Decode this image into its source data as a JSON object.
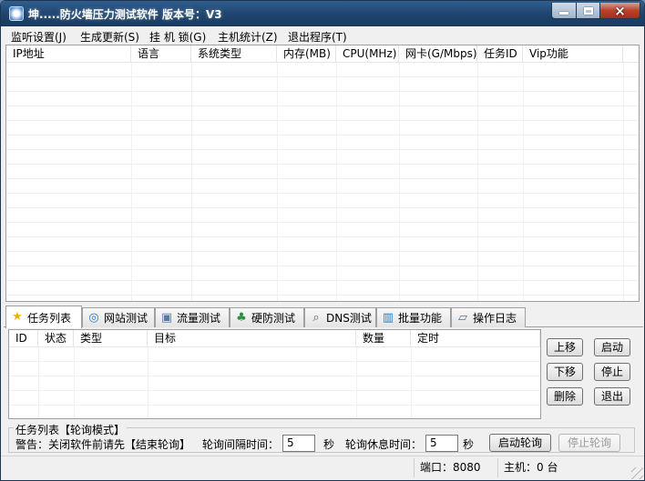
{
  "window": {
    "title": "坤.....防火墙压力测试软件  版本号：V3"
  },
  "menu": [
    "监听设置(J)",
    "生成更新(S)",
    "挂 机 锁(G)",
    "主机统计(Z)",
    "退出程序(T)"
  ],
  "host_table": {
    "headers": [
      "IP地址",
      "语言",
      "系统类型",
      "内存(MB)",
      "CPU(MHz)",
      "网卡(G/Mbps)",
      "任务ID",
      "Vip功能"
    ]
  },
  "tabs": [
    {
      "label": "任务列表",
      "icon": "star-icon"
    },
    {
      "label": "网站测试",
      "icon": "globe-icon"
    },
    {
      "label": "流量测试",
      "icon": "cube-icon"
    },
    {
      "label": "硬防测试",
      "icon": "network-icon"
    },
    {
      "label": "DNS测试",
      "icon": "magnifier-icon"
    },
    {
      "label": "批量功能",
      "icon": "bar-chart-icon"
    },
    {
      "label": "操作日志",
      "icon": "chat-bubbles-icon"
    }
  ],
  "task_table": {
    "headers": [
      "ID",
      "状态",
      "类型",
      "目标",
      "数量",
      "定时"
    ]
  },
  "side_buttons": {
    "move_up": "上移",
    "start": "启动",
    "move_down": "下移",
    "stop": "停止",
    "delete": "删除",
    "exit": "退出"
  },
  "polling": {
    "group_title": "任务列表【轮询模式】",
    "warning": "警告：关闭软件前请先【结束轮询】",
    "interval_label": "轮询间隔时间：",
    "interval_value": "5",
    "interval_unit": "秒",
    "rest_label": "轮询休息时间：",
    "rest_value": "5",
    "rest_unit": "秒",
    "start_button": "启动轮询",
    "stop_button": "停止轮询"
  },
  "status": {
    "port": "端口：8080",
    "hosts": "主机：0 台"
  },
  "colors": {
    "titlebar": "#1f456f",
    "window_bg": "#f0f0f0",
    "grid_border": "#a0a0a0"
  }
}
